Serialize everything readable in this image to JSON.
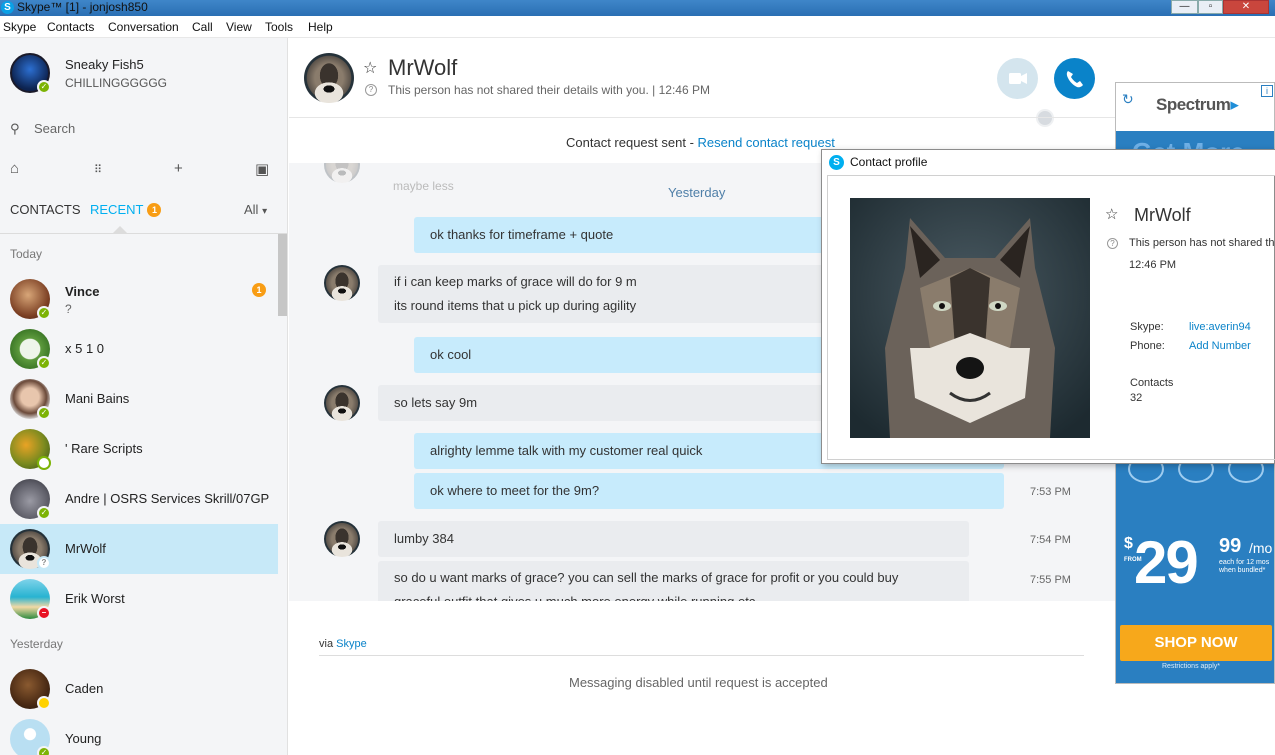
{
  "window": {
    "title": "Skype™ [1] - jonjosh850"
  },
  "menu": [
    "Skype",
    "Contacts",
    "Conversation",
    "Call",
    "View",
    "Tools",
    "Help"
  ],
  "me": {
    "name": "Sneaky Fish5",
    "mood": "CHILLINGGGGGG",
    "status": "online"
  },
  "search": {
    "placeholder": "Search"
  },
  "tabs": {
    "contacts": "CONTACTS",
    "recent": "RECENT",
    "recent_badge": "1",
    "filter": "All"
  },
  "sections": {
    "today": "Today",
    "yesterday": "Yesterday"
  },
  "contacts": [
    {
      "name": "Vince",
      "sub": "?",
      "badge": "1",
      "bold": true,
      "status": "online"
    },
    {
      "name": "x 5 1 0",
      "status": "online"
    },
    {
      "name": "Mani Bains",
      "status": "online"
    },
    {
      "name": "' Rare Scripts",
      "status": "offline"
    },
    {
      "name": "Andre | OSRS Services Skrill/07GP",
      "status": "online"
    },
    {
      "name": "MrWolf",
      "status": "unknown",
      "selected": true
    },
    {
      "name": "Erik Worst",
      "status": "dnd"
    },
    {
      "name": "Caden",
      "status": "away"
    },
    {
      "name": "Young",
      "status": "online"
    }
  ],
  "conversation": {
    "name": "MrWolf",
    "info": "This person has not shared their details with you.  |  12:46 PM",
    "request_text": "Contact request sent - ",
    "request_link": "Resend contact request",
    "faded_text": "maybe less",
    "day_label": "Yesterday",
    "messages": [
      {
        "text": "ok thanks for timeframe + quote",
        "mine": true
      },
      {
        "line1": "if i can keep marks of grace will do for 9 m",
        "line2": "its round items that u pick up during agility"
      },
      {
        "text": "ok cool",
        "mine": true
      },
      {
        "text": "so lets say 9m"
      },
      {
        "text": "alrighty lemme talk with my customer real quick",
        "mine": true
      },
      {
        "text": "ok where to meet for the 9m?",
        "mine": true,
        "time": "7:53 PM"
      },
      {
        "text": "lumby 384",
        "time": "7:54 PM"
      },
      {
        "line1": "so do u want marks of grace? you can sell the marks of grace for profit or you could buy",
        "line2": "graceful outfit that gives u much more energy while running etc",
        "time": "7:55 PM"
      }
    ],
    "via_prefix": "via ",
    "via_link": "Skype",
    "disabled": "Messaging disabled until request is accepted"
  },
  "profile": {
    "window_title": "Contact profile",
    "name": "MrWolf",
    "info": "This person has not shared their details with you.",
    "time": "12:46 PM",
    "skype_label": "Skype:",
    "skype_value": "live:averin94",
    "phone_label": "Phone:",
    "phone_value": "Add Number",
    "contacts_label": "Contacts",
    "contacts_value": "32"
  },
  "ad": {
    "brand": "Spectrum",
    "headline": "Get More",
    "dollar": "$",
    "from": "FROM",
    "price": "29",
    "cents": "99",
    "per": "/mo",
    "fine": "each for 12 mos when bundled*",
    "cta": "SHOP NOW",
    "restrictions": "Restrictions apply*",
    "info": "i"
  },
  "colors": {
    "accent": "#00aff0",
    "link": "#0a83c9",
    "selected": "#c7e9f8",
    "mine_bubble": "#c7ebfc",
    "their_bubble": "#eaecef",
    "badge": "#f89d15"
  }
}
